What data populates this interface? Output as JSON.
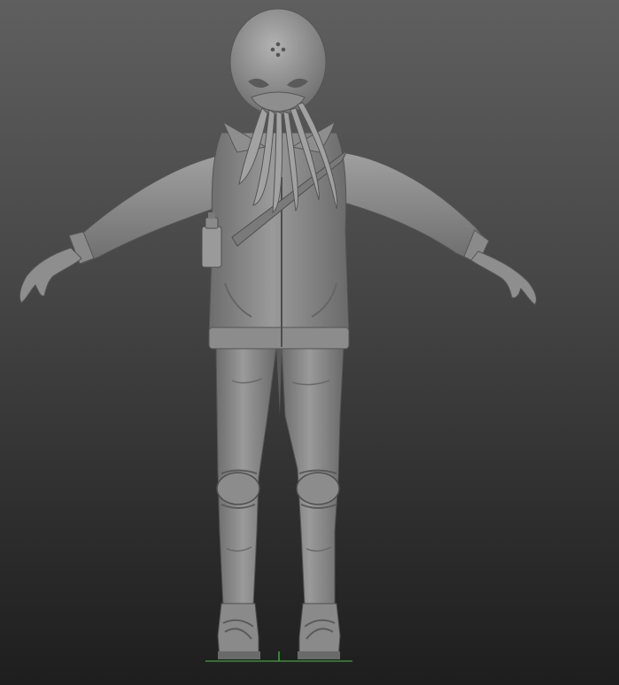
{
  "scene": {
    "subject": "octopus-mask-character-sculpt",
    "colors": {
      "bg_top": "#5f5f5f",
      "bg_bottom": "#1e1e1e",
      "clay_light": "#a8a8a8",
      "clay_mid": "#7f7f7f",
      "clay_dark": "#4f4f4f",
      "floor_axis_x": "#3c8a3c",
      "floor_axis_y": "#2fae2f"
    }
  }
}
